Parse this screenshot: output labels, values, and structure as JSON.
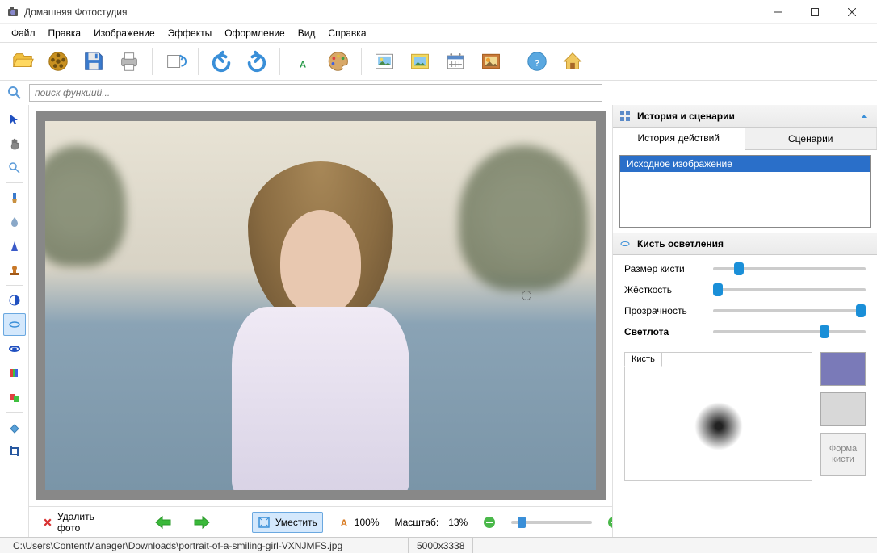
{
  "app": {
    "title": "Домашняя Фотостудия"
  },
  "menubar": {
    "items": [
      "Файл",
      "Правка",
      "Изображение",
      "Эффекты",
      "Оформление",
      "Вид",
      "Справка"
    ]
  },
  "search": {
    "placeholder": "поиск функций..."
  },
  "canvas_bar": {
    "delete_label": "Удалить фото",
    "fit_label": "Уместить",
    "zoom100_label": "100%",
    "scale_label": "Масштаб:",
    "scale_value": "13%"
  },
  "right": {
    "history_title": "История и сценарии",
    "tabs": {
      "history": "История действий",
      "scenarios": "Сценарии"
    },
    "history_items": [
      "Исходное изображение"
    ],
    "brush_title": "Кисть осветления",
    "params": {
      "size": "Размер кисти",
      "hardness": "Жёсткость",
      "opacity": "Прозрачность",
      "lightness": "Светлота"
    },
    "slider_pos": {
      "size": 14,
      "hardness": 0,
      "opacity": 100,
      "lightness": 70
    },
    "brush_preview_label": "Кисть",
    "shape_btn": "Форма кисти",
    "colors": {
      "fg": "#7a7ab8",
      "bg": "#d8d8d8"
    }
  },
  "statusbar": {
    "path": "C:\\Users\\ContentManager\\Downloads\\portrait-of-a-smiling-girl-VXNJMFS.jpg",
    "dimensions": "5000x3338"
  }
}
